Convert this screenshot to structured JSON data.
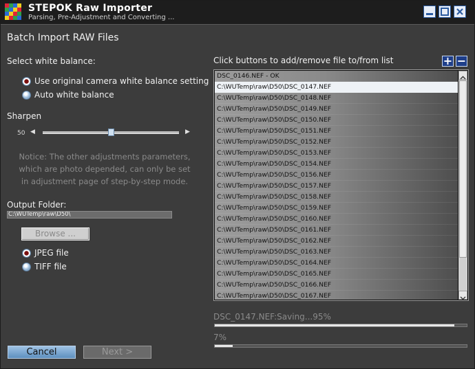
{
  "titlebar": {
    "title": "STEPOK Raw Importer",
    "subtitle": "Parsing, Pre-Adjustment and Converting ..."
  },
  "page": {
    "heading": "Batch Import RAW Files"
  },
  "white_balance": {
    "label": "Select white balance:",
    "options": [
      {
        "label": "Use original camera white balance setting",
        "selected": true
      },
      {
        "label": "Auto white balance",
        "selected": false
      }
    ]
  },
  "sharpen": {
    "label": "Sharpen",
    "value": "50",
    "slider_fraction": 0.5
  },
  "notice": "Notice: The other adjustments parameters, which are photo depended, can only be set in adjustment page of step-by-step mode.",
  "output": {
    "label": "Output Folder:",
    "path": "C:\\WUTemp\\raw\\D50\\",
    "browse_label": "Browse ..."
  },
  "format": {
    "options": [
      {
        "label": "JPEG file",
        "selected": true
      },
      {
        "label": "TIFF file",
        "selected": false
      }
    ]
  },
  "files": {
    "instruction": "Click buttons to add/remove file to/from list",
    "add_label": "+",
    "remove_label": "−",
    "items": [
      "DSC_0146.NEF - OK",
      "C:\\WUTemp\\raw\\D50\\DSC_0147.NEF",
      "C:\\WUTemp\\raw\\D50\\DSC_0148.NEF",
      "C:\\WUTemp\\raw\\D50\\DSC_0149.NEF",
      "C:\\WUTemp\\raw\\D50\\DSC_0150.NEF",
      "C:\\WUTemp\\raw\\D50\\DSC_0151.NEF",
      "C:\\WUTemp\\raw\\D50\\DSC_0152.NEF",
      "C:\\WUTemp\\raw\\D50\\DSC_0153.NEF",
      "C:\\WUTemp\\raw\\D50\\DSC_0154.NEF",
      "C:\\WUTemp\\raw\\D50\\DSC_0156.NEF",
      "C:\\WUTemp\\raw\\D50\\DSC_0157.NEF",
      "C:\\WUTemp\\raw\\D50\\DSC_0158.NEF",
      "C:\\WUTemp\\raw\\D50\\DSC_0159.NEF",
      "C:\\WUTemp\\raw\\D50\\DSC_0160.NEF",
      "C:\\WUTemp\\raw\\D50\\DSC_0161.NEF",
      "C:\\WUTemp\\raw\\D50\\DSC_0162.NEF",
      "C:\\WUTemp\\raw\\D50\\DSC_0163.NEF",
      "C:\\WUTemp\\raw\\D50\\DSC_0164.NEF",
      "C:\\WUTemp\\raw\\D50\\DSC_0165.NEF",
      "C:\\WUTemp\\raw\\D50\\DSC_0166.NEF",
      "C:\\WUTemp\\raw\\D50\\DSC_0167.NEF"
    ],
    "selected_index": 1
  },
  "progress": {
    "file_status": "DSC_0147.NEF:Saving...95%",
    "file_fraction": 0.95,
    "overall_status": "7%",
    "overall_fraction": 0.07
  },
  "buttons": {
    "cancel": "Cancel",
    "next": "Next >"
  },
  "colors": {
    "accent": "#1f3f8a",
    "background": "#3c3c3c",
    "titlebar": "#1d1d1d"
  }
}
